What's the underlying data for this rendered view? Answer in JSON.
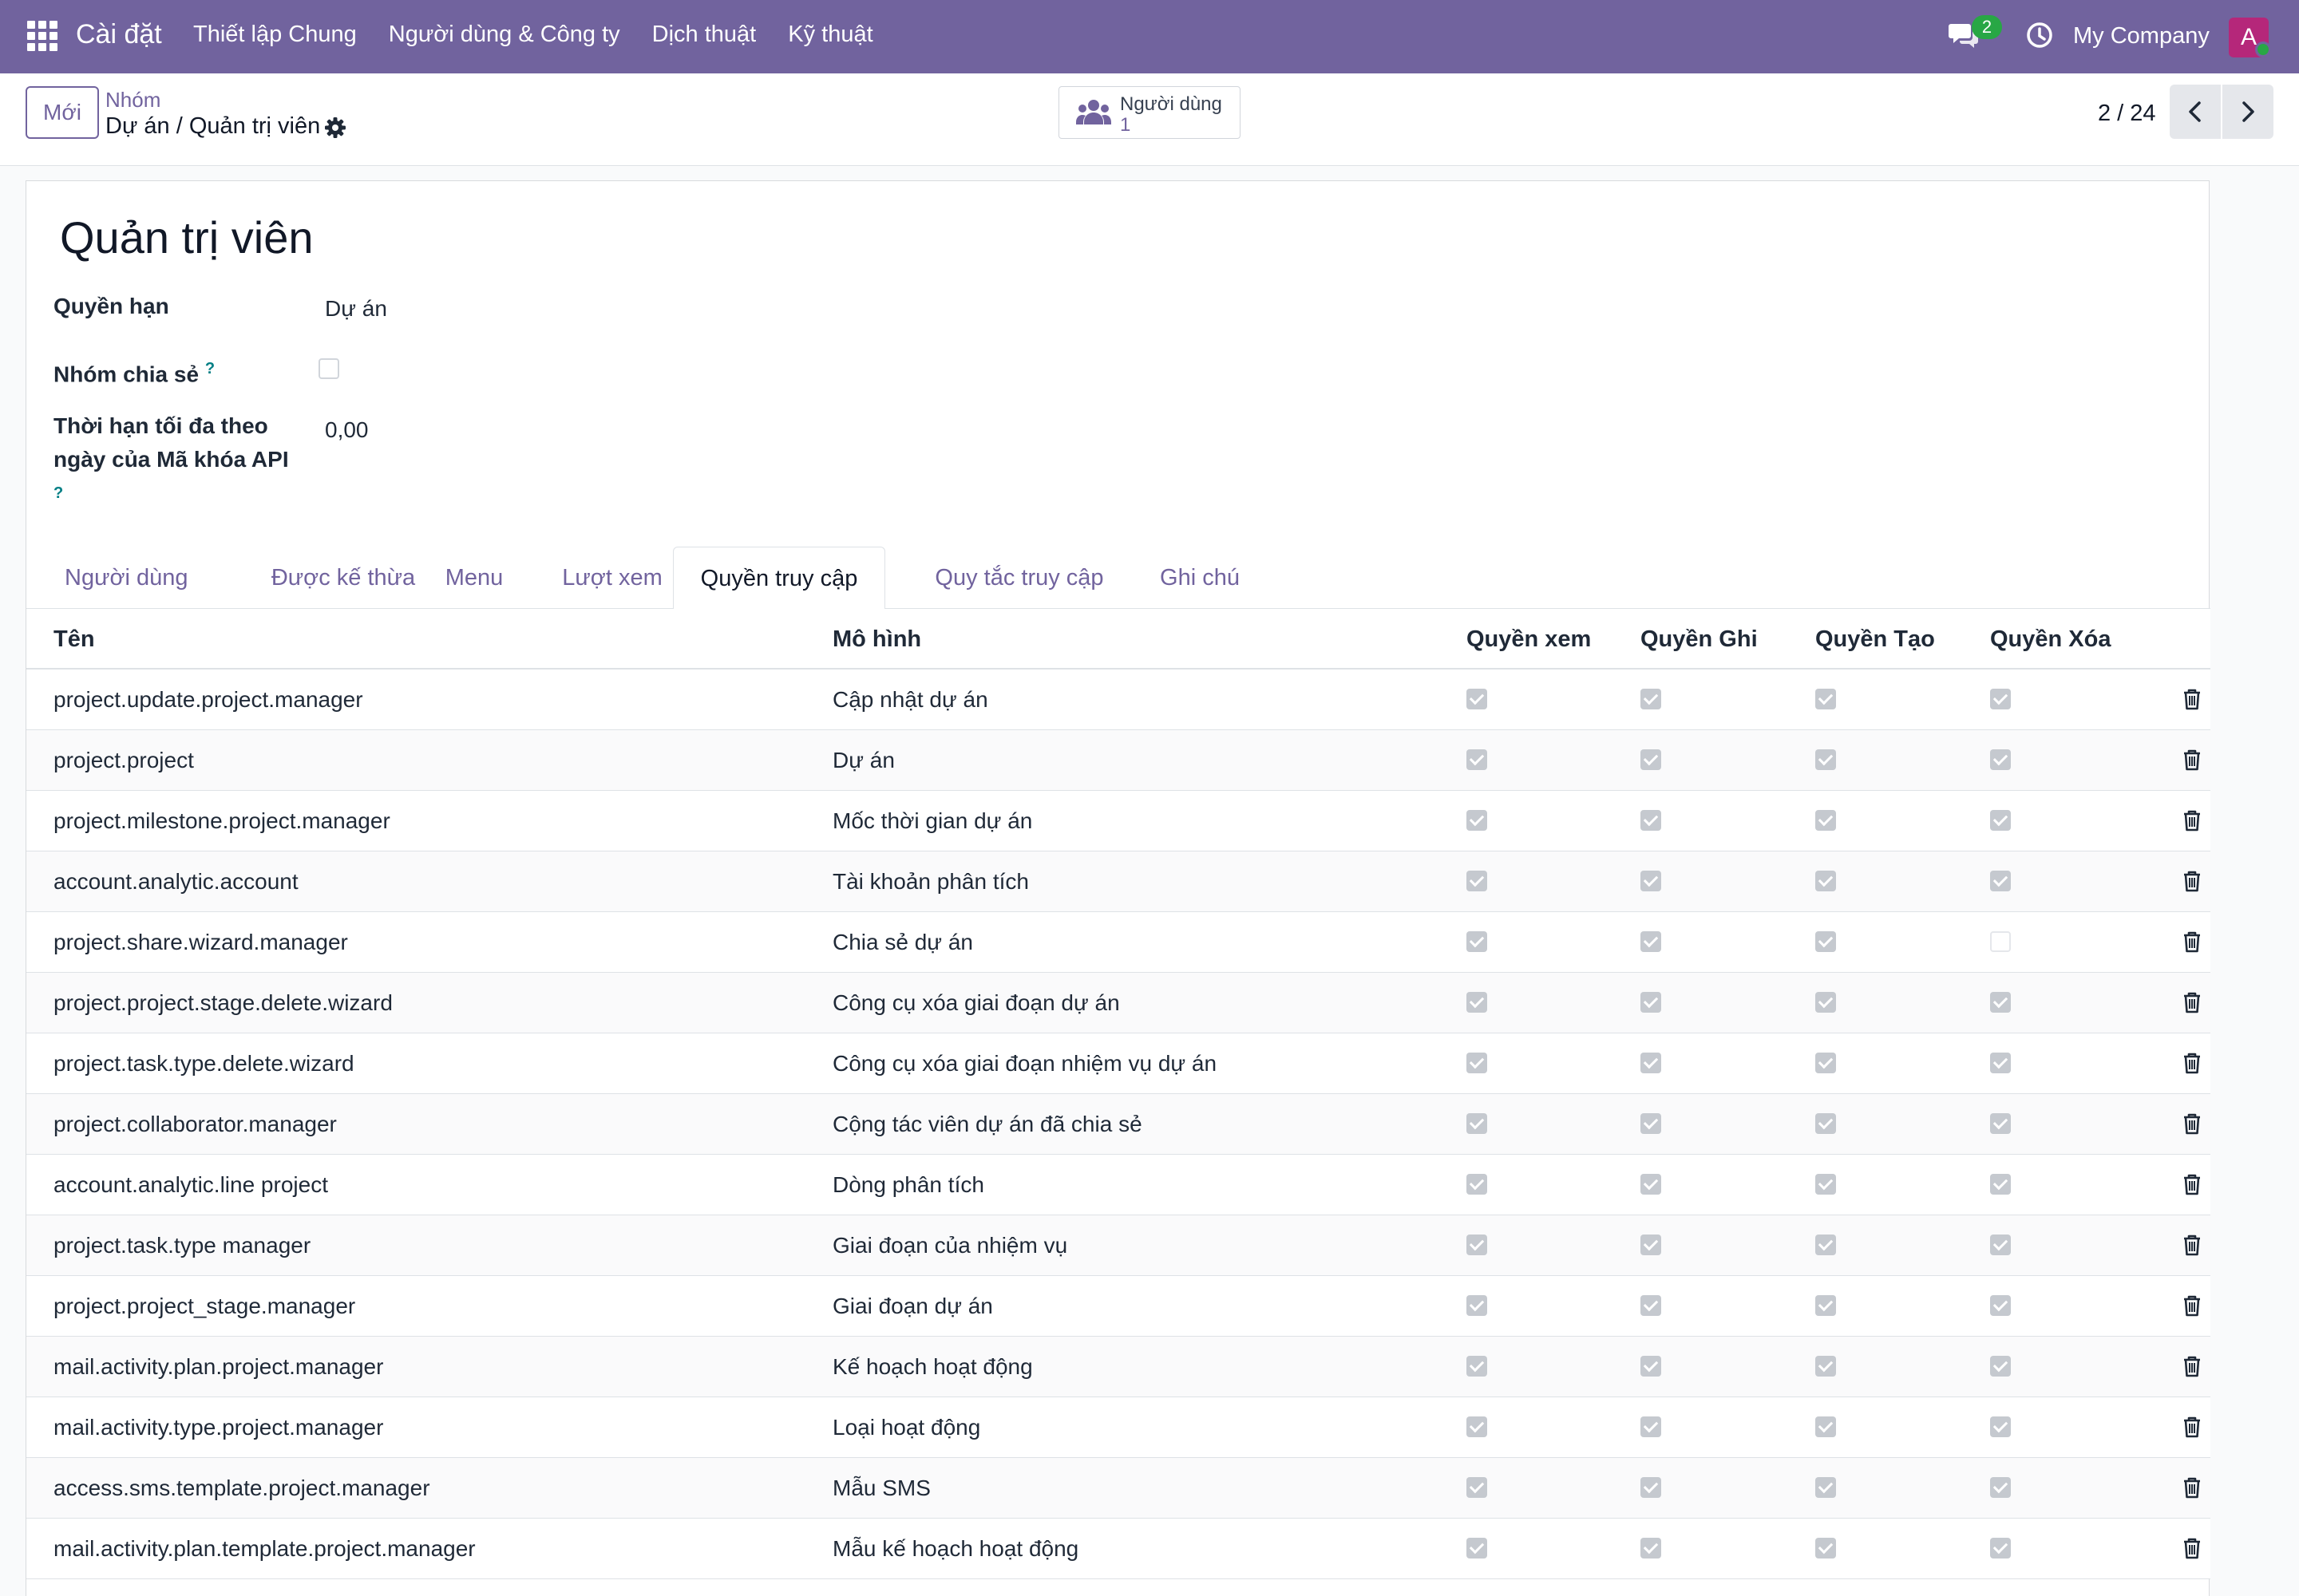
{
  "navbar": {
    "app_title": "Cài đặt",
    "menu": [
      "Thiết lập Chung",
      "Người dùng & Công ty",
      "Dịch thuật",
      "Kỹ thuật"
    ],
    "chat_badge": "2",
    "company": "My Company",
    "avatar_letter": "A",
    "color": "#71639e"
  },
  "control_panel": {
    "new_label": "Mới",
    "breadcrumb_parent": "Nhóm",
    "breadcrumb_current": "Dự án / Quản trị viên",
    "users_stat_label": "Người dùng",
    "users_stat_value": "1",
    "pager": "2 / 24"
  },
  "form": {
    "title": "Quản trị viên",
    "fields": {
      "application_label": "Quyền hạn",
      "application_value": "Dự án",
      "share_label": "Nhóm chia sẻ",
      "api_label": "Thời hạn tối đa theo ngày của Mã khóa API",
      "api_value": "0,00",
      "help_mark": "?"
    }
  },
  "tabs": [
    "Người dùng",
    "Được kế thừa",
    "Menu",
    "Lượt xem",
    "Quyền truy cập",
    "Quy tắc truy cập",
    "Ghi chú"
  ],
  "active_tab": "Quyền truy cập",
  "table": {
    "columns": [
      "Tên",
      "Mô hình",
      "Quyền xem",
      "Quyền Ghi",
      "Quyền Tạo",
      "Quyền Xóa"
    ],
    "rows": [
      {
        "name": "project.update.project.manager",
        "model": "Cập nhật dự án",
        "read": true,
        "write": true,
        "create": true,
        "unlink": true
      },
      {
        "name": "project.project",
        "model": "Dự án",
        "read": true,
        "write": true,
        "create": true,
        "unlink": true
      },
      {
        "name": "project.milestone.project.manager",
        "model": "Mốc thời gian dự án",
        "read": true,
        "write": true,
        "create": true,
        "unlink": true
      },
      {
        "name": "account.analytic.account",
        "model": "Tài khoản phân tích",
        "read": true,
        "write": true,
        "create": true,
        "unlink": true
      },
      {
        "name": "project.share.wizard.manager",
        "model": "Chia sẻ dự án",
        "read": true,
        "write": true,
        "create": true,
        "unlink": false
      },
      {
        "name": "project.project.stage.delete.wizard",
        "model": "Công cụ xóa giai đoạn dự án",
        "read": true,
        "write": true,
        "create": true,
        "unlink": true
      },
      {
        "name": "project.task.type.delete.wizard",
        "model": "Công cụ xóa giai đoạn nhiệm vụ dự án",
        "read": true,
        "write": true,
        "create": true,
        "unlink": true
      },
      {
        "name": "project.collaborator.manager",
        "model": "Cộng tác viên dự án đã chia sẻ",
        "read": true,
        "write": true,
        "create": true,
        "unlink": true
      },
      {
        "name": "account.analytic.line project",
        "model": "Dòng phân tích",
        "read": true,
        "write": true,
        "create": true,
        "unlink": true
      },
      {
        "name": "project.task.type manager",
        "model": "Giai đoạn của nhiệm vụ",
        "read": true,
        "write": true,
        "create": true,
        "unlink": true
      },
      {
        "name": "project.project_stage.manager",
        "model": "Giai đoạn dự án",
        "read": true,
        "write": true,
        "create": true,
        "unlink": true
      },
      {
        "name": "mail.activity.plan.project.manager",
        "model": "Kế hoạch hoạt động",
        "read": true,
        "write": true,
        "create": true,
        "unlink": true
      },
      {
        "name": "mail.activity.type.project.manager",
        "model": "Loại hoạt động",
        "read": true,
        "write": true,
        "create": true,
        "unlink": true
      },
      {
        "name": "access.sms.template.project.manager",
        "model": "Mẫu SMS",
        "read": true,
        "write": true,
        "create": true,
        "unlink": true
      },
      {
        "name": "mail.activity.plan.template.project.manager",
        "model": "Mẫu kế hoạch hoạt động",
        "read": true,
        "write": true,
        "create": true,
        "unlink": true
      }
    ]
  }
}
